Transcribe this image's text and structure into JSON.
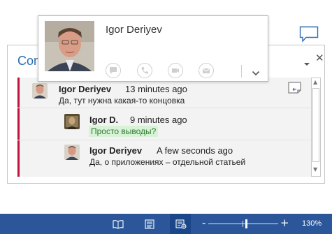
{
  "pane": {
    "title": "Comments",
    "close_glyph": "✕",
    "menu_icon": "chevron-down-icon"
  },
  "card": {
    "name": "Igor Deriyev",
    "actions": [
      "instant-message-icon",
      "phone-icon",
      "video-call-icon",
      "email-icon"
    ],
    "expand_icon": "chevron-down-icon"
  },
  "comments": [
    {
      "author": "Igor Deriyev",
      "time": "13 minutes ago",
      "text": "Да, тут нужна какая-то концовка"
    },
    {
      "author": "Igor D.",
      "time": "9 minutes ago",
      "text": "Просто выводы?",
      "highlighted": true
    },
    {
      "author": "Igor Deriyev",
      "time": "A few seconds ago",
      "text": "Да, о приложениях – отдельной статьей"
    }
  ],
  "statusbar": {
    "views": [
      "read-mode-icon",
      "print-layout-icon",
      "web-layout-icon"
    ],
    "active_view": "web-layout-icon",
    "zoom_minus": "-",
    "zoom_plus": "+",
    "zoom_level": "130%"
  },
  "colors": {
    "accent": "#2b579a",
    "title_blue": "#2b6db3",
    "thread_bar": "#c1133a",
    "highlight_bg": "#d8f2d8",
    "highlight_text": "#2e7b2e"
  }
}
